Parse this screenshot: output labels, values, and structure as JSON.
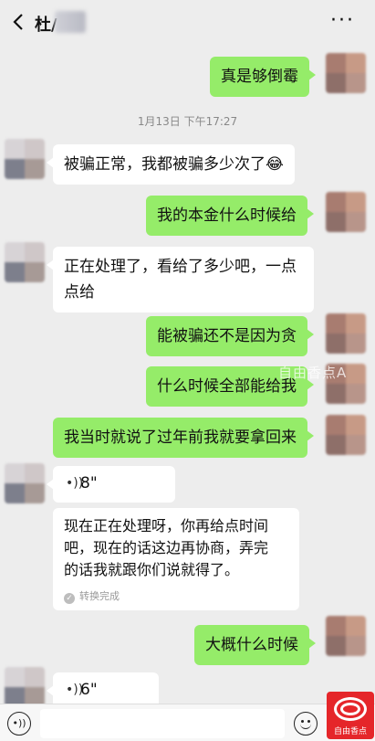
{
  "header": {
    "title": "杜/",
    "more_icon": "more-dots-icon"
  },
  "timestamp": "1月13日 下午17:27",
  "messages": {
    "m1": "真是够倒霉",
    "m2": "被骗正常，我都被骗多少次了😂",
    "m3": "我的本金什么时候给",
    "m4a": "正在处理了，看给了多少吧，一点",
    "m4b": "点给",
    "m5": "能被骗还不是因为贪",
    "m6": "什么时候全部能给我",
    "m7": "我当时就说了过年前我就要拿回来",
    "v1": "8\"",
    "t1a": "现在正在处理呀，你再给点时间",
    "t1b": "吧，现在的话这边再协商，弄完",
    "t1c": "的话我就跟你们说就得了。",
    "t1_status": "转换完成",
    "m8": "大概什么时候",
    "v2": "6\""
  },
  "watermark": "自由香点A",
  "logo_text": "自由香点",
  "colors": {
    "sent": "#95ec69",
    "received": "#ffffff",
    "background": "#ededed",
    "logo": "#e5262a"
  }
}
